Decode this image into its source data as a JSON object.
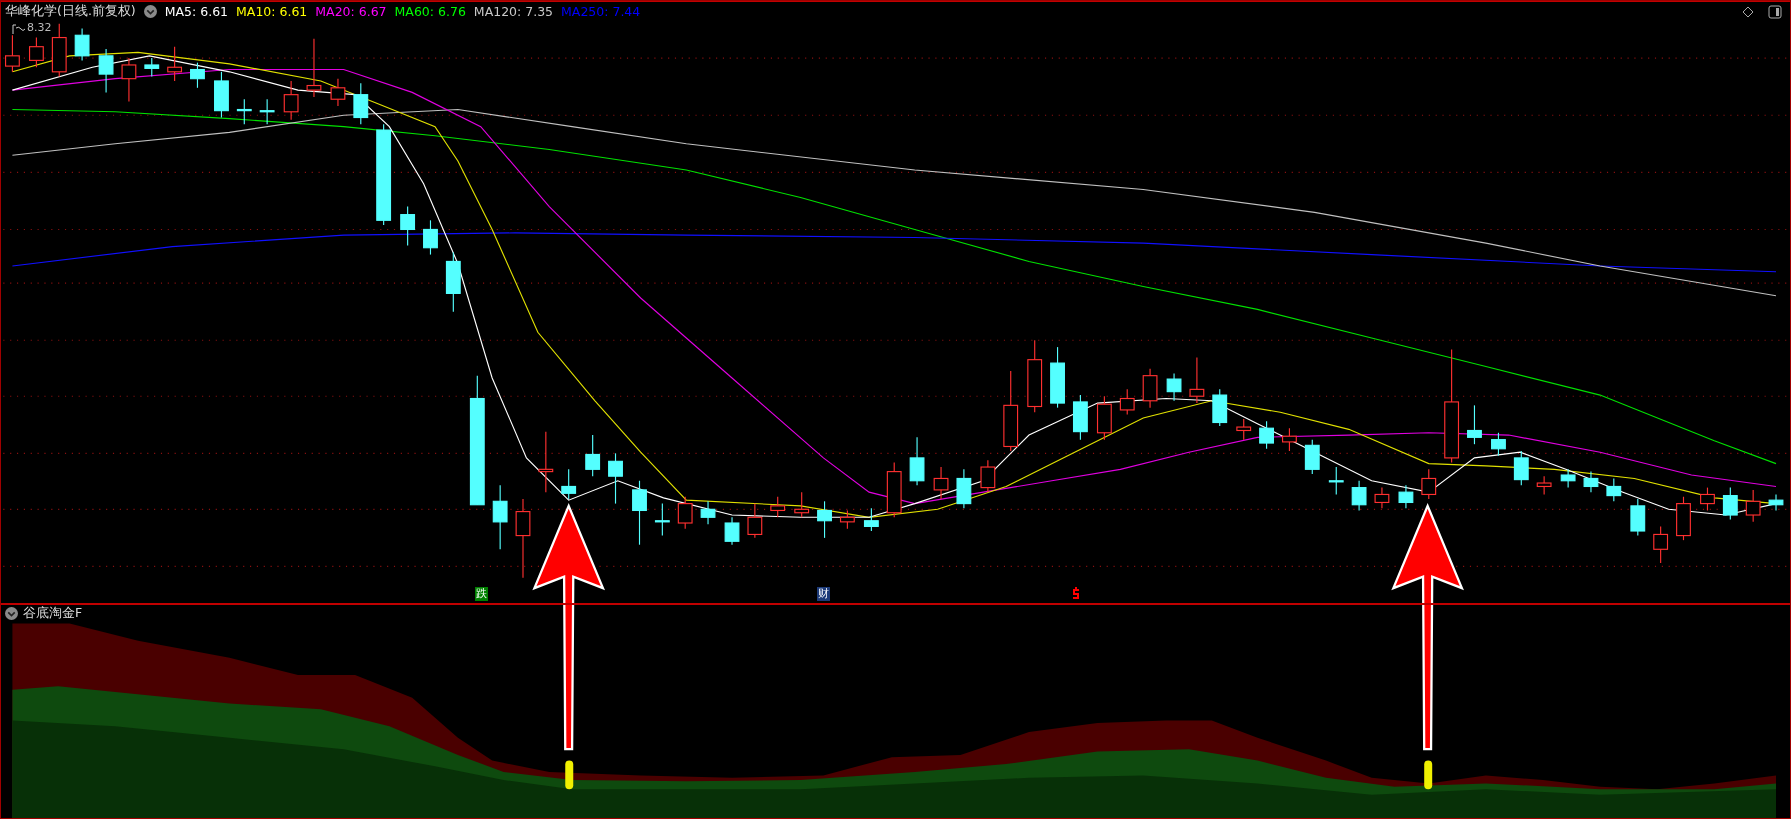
{
  "chart_header": {
    "title": "华峰化学(日线.前复权)",
    "ma_legend": [
      {
        "label": "MA5: 6.61",
        "color": "#ffffff"
      },
      {
        "label": "MA10: 6.61",
        "color": "#ffff00"
      },
      {
        "label": "MA20: 6.67",
        "color": "#ff00ff"
      },
      {
        "label": "MA60: 6.76",
        "color": "#00ff00"
      },
      {
        "label": "MA120: 7.35",
        "color": "#c8c8c8"
      },
      {
        "label": "MA250: 7.44",
        "color": "#0000ff"
      }
    ]
  },
  "high_label": "8.32",
  "event_markers": [
    {
      "kind": "badge",
      "text": "跌",
      "color": "#008000"
    },
    {
      "kind": "badge",
      "text": "财",
      "color": "#1c3a78"
    },
    {
      "kind": "icon",
      "color": "#ff0000"
    }
  ],
  "indicator_panel": {
    "title": "谷底淘金F"
  }
}
